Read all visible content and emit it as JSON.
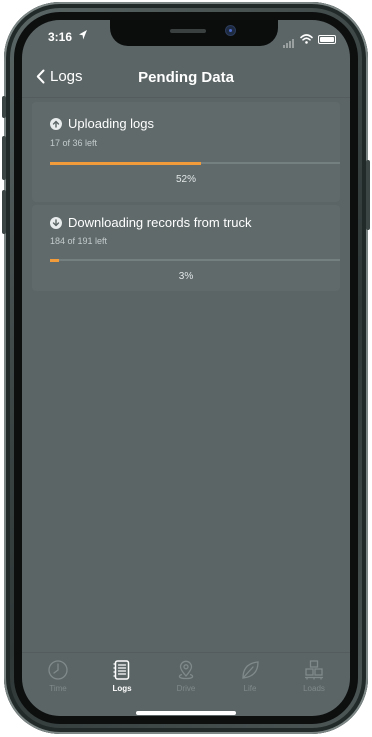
{
  "status_bar": {
    "time": "3:16",
    "location_icon": "location-arrow-icon",
    "signal_icon": "cellular-signal-icon",
    "wifi_icon": "wifi-icon",
    "battery_icon": "battery-icon"
  },
  "nav": {
    "back_label": "Logs",
    "back_icon": "chevron-left-icon",
    "title": "Pending Data"
  },
  "transfers": [
    {
      "icon": "upload-arrow-icon",
      "title": "Uploading logs",
      "subtitle": "17 of 36 left",
      "progress_label": "52%",
      "progress": 0.52
    },
    {
      "icon": "download-arrow-icon",
      "title": "Downloading records from truck",
      "subtitle": "184 of 191 left",
      "progress_label": "3%",
      "progress": 0.03
    }
  ],
  "tabs": [
    {
      "label": "Time",
      "icon": "clock-icon",
      "active": false
    },
    {
      "label": "Logs",
      "icon": "logbook-icon",
      "active": true
    },
    {
      "label": "Drive",
      "icon": "map-pin-icon",
      "active": false
    },
    {
      "label": "Life",
      "icon": "leaf-icon",
      "active": false
    },
    {
      "label": "Loads",
      "icon": "pallet-boxes-icon",
      "active": false
    }
  ],
  "colors": {
    "screen_background": "#5c6566",
    "progress_fill": "#f29b3a",
    "tab_inactive": "#818a8a",
    "tab_active": "#ffffff"
  }
}
